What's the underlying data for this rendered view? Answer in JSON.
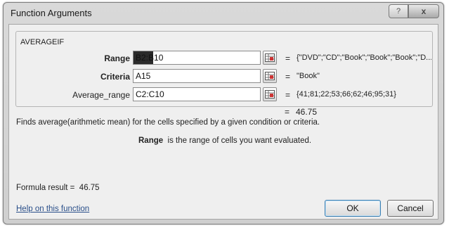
{
  "window": {
    "title": "Function Arguments",
    "help_glyph": "?",
    "close_glyph": "x"
  },
  "function_group": {
    "name": "AVERAGEIF",
    "args": [
      {
        "label": "Range",
        "value": "B2:B10",
        "result": "{\"DVD\";\"CD\";\"Book\";\"Book\";\"Book\";\"D..."
      },
      {
        "label": "Criteria",
        "value": "A15",
        "result": "\"Book\""
      },
      {
        "label": "Average_range",
        "value": "C2:C10",
        "result": "{41;81;22;53;66;62;46;95;31}"
      }
    ],
    "equals": "="
  },
  "function_result": {
    "equals": "=",
    "value": "46.75"
  },
  "description": "Finds average(arithmetic mean) for the cells specified by a given condition or criteria.",
  "arg_help": {
    "name": "Range",
    "text": "is the range of cells you want evaluated."
  },
  "formula_result": {
    "label": "Formula result =",
    "value": "46.75"
  },
  "help_link": "Help on this function",
  "buttons": {
    "ok": "OK",
    "cancel": "Cancel"
  },
  "icons": {
    "ref": "collapse-dialog-icon"
  }
}
